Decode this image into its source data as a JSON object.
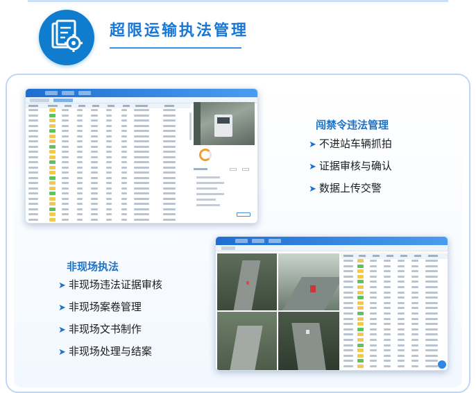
{
  "header": {
    "title": "超限运输执法管理",
    "icon": "document-gear-icon",
    "accent": "#1677d6"
  },
  "section_restriction": {
    "title": "闯禁令违法管理",
    "items": [
      "不进站车辆抓拍",
      "证据审核与确认",
      "数据上传交警"
    ]
  },
  "section_offsite": {
    "title": "非现场执法",
    "items": [
      "非现场违法证据审核",
      "非现场案卷管理",
      "非现场文书制作",
      "非现场处理与结案"
    ]
  }
}
